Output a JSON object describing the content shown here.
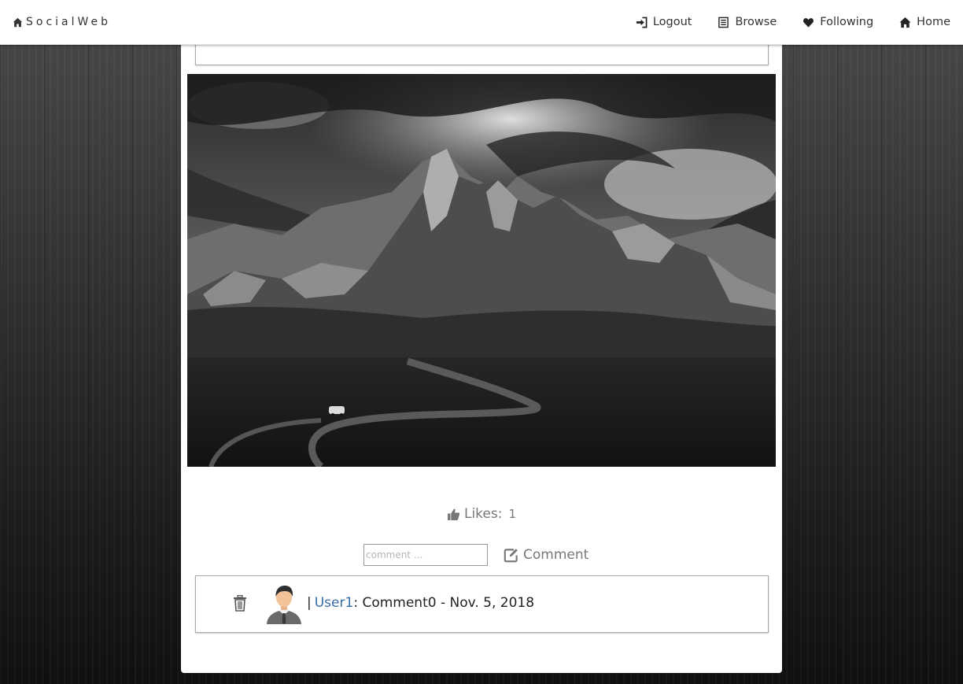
{
  "navbar": {
    "brand": "SocialWeb",
    "links": [
      {
        "label": "Logout",
        "icon": "logout-icon"
      },
      {
        "label": "Browse",
        "icon": "list-icon"
      },
      {
        "label": "Following",
        "icon": "heart-icon"
      },
      {
        "label": "Home",
        "icon": "home-icon"
      }
    ]
  },
  "post": {
    "image": "mountain-landscape-photo",
    "likes_label": "Likes:",
    "likes_count": "1"
  },
  "comment_form": {
    "placeholder": "comment ...",
    "button_label": "Comment"
  },
  "comments": [
    {
      "separator": "|",
      "user": "User1",
      "colon": ":",
      "text": " Comment0 - Nov. 5, 2018"
    }
  ],
  "colors": {
    "link_blue": "#3a6da8",
    "muted_text": "#777777",
    "border": "#aaaaaa"
  }
}
